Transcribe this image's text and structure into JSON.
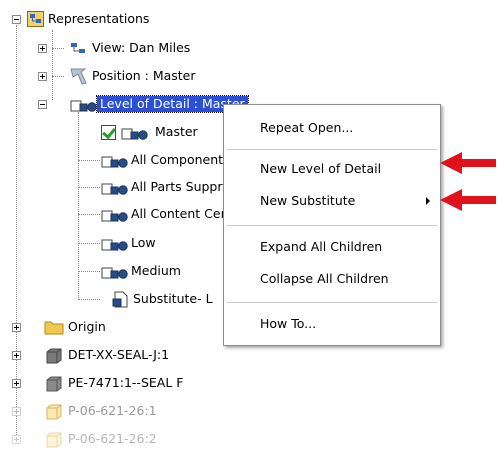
{
  "tree": {
    "representations": {
      "label": "Representations",
      "icon": "representations-icon"
    },
    "view": {
      "label": "View: Dan Miles",
      "icon": "view-icon"
    },
    "position": {
      "label": "Position : Master",
      "icon": "position-icon"
    },
    "level_of_detail": {
      "label": "Level of Detail : Master",
      "icon": "level-of-detail-icon"
    },
    "lod_items": [
      {
        "label": "Master",
        "checked": true
      },
      {
        "label": "All Components Suppressed"
      },
      {
        "label": "All Parts Suppressed"
      },
      {
        "label": "All Content Center Suppressed"
      },
      {
        "label": "Low"
      },
      {
        "label": "Medium"
      },
      {
        "label": "Substitute- L"
      }
    ],
    "origin": {
      "label": "Origin",
      "icon": "folder-icon"
    },
    "parts": [
      {
        "label": "DET-XX-SEAL-J:1"
      },
      {
        "label": "PE-7471:1--SEAL F"
      },
      {
        "label": "P-06-621-26:1"
      },
      {
        "label": "P-06-621-26:2"
      }
    ]
  },
  "context_menu": {
    "repeat_open": "Repeat Open...",
    "new_level_of_detail": "New Level of Detail",
    "new_substitute": "New Substitute",
    "expand_all": "Expand All Children",
    "collapse_all": "Collapse All Children",
    "how_to": "How To..."
  },
  "colors": {
    "selection": "#2b4fd6",
    "callout_arrow": "#e0121b",
    "folder": "#f2c94c"
  }
}
